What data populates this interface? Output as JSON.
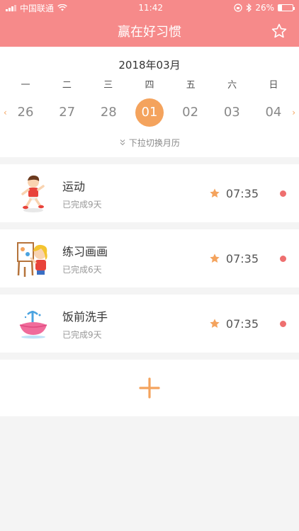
{
  "status": {
    "carrier": "中国联通",
    "time": "11:42",
    "battery": "26%",
    "battery_level": 0.26
  },
  "header": {
    "title": "赢在好习惯",
    "star_icon": "star-outline-icon"
  },
  "calendar": {
    "month": "2018年03月",
    "weekdays": [
      "一",
      "二",
      "三",
      "四",
      "五",
      "六",
      "日"
    ],
    "dates": [
      "26",
      "27",
      "28",
      "01",
      "02",
      "03",
      "04"
    ],
    "selected": "01",
    "hint": "下拉切换月历",
    "prev_arrow": "‹",
    "next_arrow": "›",
    "accent": "#f4a35d"
  },
  "habits": [
    {
      "name": "运动",
      "progress": "已完成9天",
      "time": "07:35"
    },
    {
      "name": "练习画画",
      "progress": "已完成6天",
      "time": "07:35"
    },
    {
      "name": "饭前洗手",
      "progress": "已完成9天",
      "time": "07:35"
    }
  ],
  "add_icon": "plus-icon",
  "colors": {
    "header": "#f68a8a",
    "accent": "#f4a35d",
    "dot": "#ee6f6f"
  }
}
